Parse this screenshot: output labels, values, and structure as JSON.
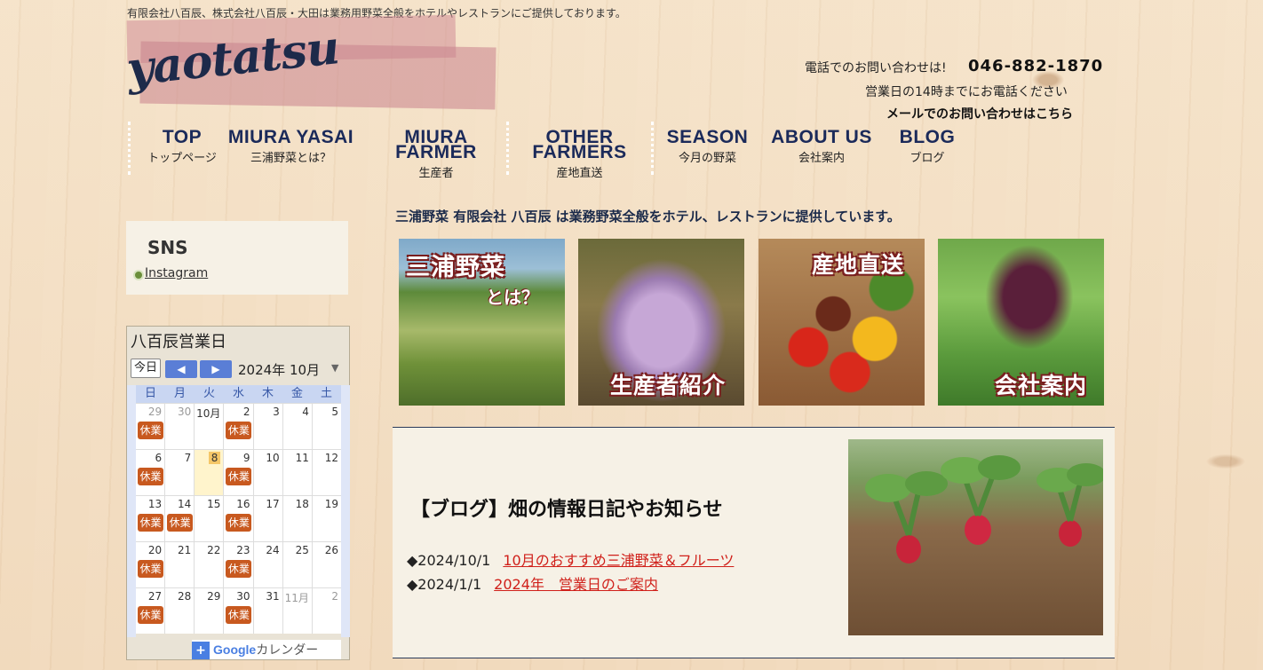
{
  "header": {
    "tagline": "有限会社八百辰、株式会社八百辰・大田は業務用野菜全般をホテルやレストランにご提供しております。",
    "logo": "yaotatsu",
    "phone_label": "電話でのお問い合わせは!",
    "phone_number": "046-882-1870",
    "hours_note": "営業日の14時までにお電話ください",
    "mail_link": "メールでのお問い合わせはこちら"
  },
  "nav": {
    "items": [
      {
        "en": "TOP",
        "jp": "トップページ"
      },
      {
        "en": "MIURA YASAI",
        "jp": "三浦野菜とは？"
      },
      {
        "en": "MIURA FARMER",
        "jp": "生産者"
      },
      {
        "en": "OTHER FARMERS",
        "jp": "産地直送"
      },
      {
        "en": "SEASON",
        "jp": "今月の野菜"
      },
      {
        "en": "ABOUT US",
        "jp": "会社案内"
      },
      {
        "en": "BLOG",
        "jp": "ブログ"
      }
    ]
  },
  "sidebar": {
    "sns_title": "SNS",
    "sns_link": "Instagram",
    "calendar": {
      "title": "八百辰営業日",
      "today_label": "今日",
      "prev_label": "◀",
      "next_label": "▶",
      "month_label": "2024年 10月",
      "dropdown": "▼",
      "weekdays": [
        "日",
        "月",
        "火",
        "水",
        "木",
        "金",
        "土"
      ],
      "event_label": "休業",
      "weeks": [
        [
          {
            "d": "29",
            "other": true,
            "ev": true
          },
          {
            "d": "30",
            "other": true
          },
          {
            "d": "10月"
          },
          {
            "d": "2",
            "ev": true
          },
          {
            "d": "3"
          },
          {
            "d": "4"
          },
          {
            "d": "5"
          }
        ],
        [
          {
            "d": "6",
            "ev": true
          },
          {
            "d": "7"
          },
          {
            "d": "8",
            "today": true
          },
          {
            "d": "9",
            "ev": true
          },
          {
            "d": "10"
          },
          {
            "d": "11"
          },
          {
            "d": "12"
          }
        ],
        [
          {
            "d": "13",
            "ev": true
          },
          {
            "d": "14",
            "ev": true
          },
          {
            "d": "15"
          },
          {
            "d": "16",
            "ev": true
          },
          {
            "d": "17"
          },
          {
            "d": "18"
          },
          {
            "d": "19"
          }
        ],
        [
          {
            "d": "20",
            "ev": true
          },
          {
            "d": "21"
          },
          {
            "d": "22"
          },
          {
            "d": "23",
            "ev": true
          },
          {
            "d": "24"
          },
          {
            "d": "25"
          },
          {
            "d": "26"
          }
        ],
        [
          {
            "d": "27",
            "ev": true
          },
          {
            "d": "28"
          },
          {
            "d": "29"
          },
          {
            "d": "30",
            "ev": true
          },
          {
            "d": "31"
          },
          {
            "d": "11月",
            "other": true
          },
          {
            "d": "2",
            "other": true
          }
        ]
      ],
      "google_brand": "Google",
      "google_suffix": "カレンダー",
      "google_plus": "+"
    }
  },
  "main": {
    "intro": "三浦野菜 有限会社 八百辰 は業務野菜全般をホテル、レストランに提供しています。",
    "tiles": [
      {
        "label": "三浦野菜",
        "sub": "とは？"
      },
      {
        "label": "生産者紹介"
      },
      {
        "label": "産地直送"
      },
      {
        "label": "会社案内"
      }
    ],
    "blog": {
      "title": "【ブログ】畑の情報日記やお知らせ",
      "posts": [
        {
          "date": "◆2024/10/1",
          "title": "10月のおすすめ三浦野菜＆フルーツ"
        },
        {
          "date": "◆2024/1/1",
          "title": "2024年　営業日のご案内"
        }
      ]
    }
  },
  "colors": {
    "navy": "#1b2a5a",
    "event": "#c8591f",
    "link_red": "#d0201a",
    "calendar_header": "#c9d6f2"
  }
}
